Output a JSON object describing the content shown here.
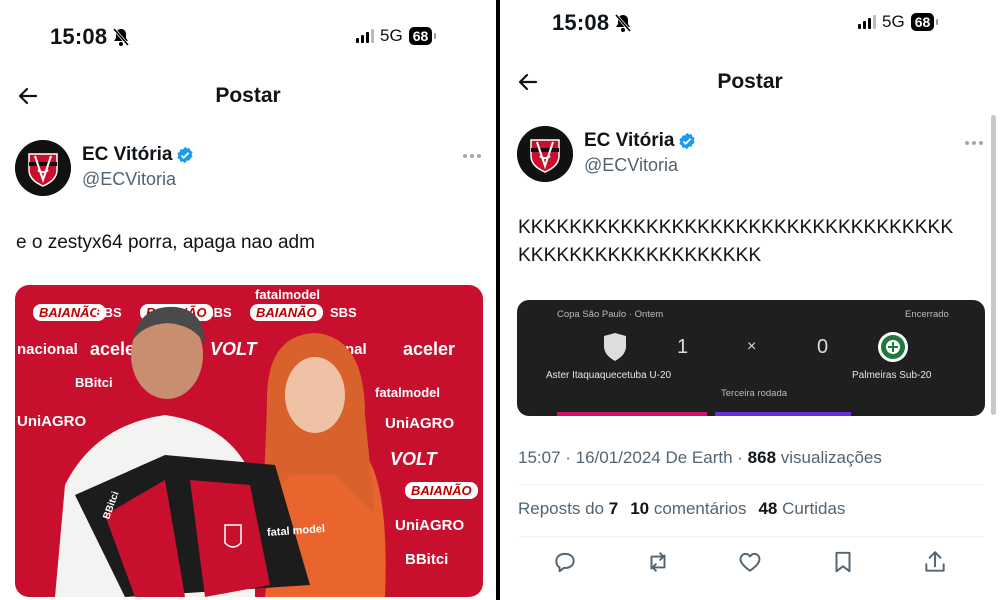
{
  "left": {
    "status": {
      "time": "15:08",
      "network": "5G",
      "battery": "68"
    },
    "nav": {
      "title": "Postar"
    },
    "author": {
      "name": "EC Vitória",
      "handle": "@ECVitoria"
    },
    "tweet_text": "e o zestyx64 porra, apaga nao adm",
    "photo": {
      "sponsors": [
        "fatalmodel",
        "BAIANÃO",
        "SBS",
        "BAIANÃO",
        "SBS",
        "BAIANÃO",
        "SBS",
        "nacional",
        "acele",
        "VOLT",
        "acional",
        "aceler",
        "BBitci",
        "fatalmodel",
        "UniAGRO",
        "UniAGRO",
        "VOLT",
        "BAIANÃO",
        "UniAGRO",
        "BBitci",
        "fatal model",
        "BBitci"
      ]
    }
  },
  "right": {
    "status": {
      "time": "15:08",
      "network": "5G",
      "battery": "68"
    },
    "nav": {
      "title": "Postar"
    },
    "author": {
      "name": "EC Vitória",
      "handle": "@ECVitoria"
    },
    "tweet_lines": [
      "KKKKKKKKKKKKKKKKKKKKKKKKKKKKKKKKKK",
      "KKKKKKKKKKKKKKKKKKK"
    ],
    "match_card": {
      "competition": "Copa São Paulo · Ontem",
      "status": "Encerrado",
      "home_team": "Aster Itaquaquecetuba U-20",
      "home_score": "1",
      "separator": "×",
      "away_score": "0",
      "away_team": "Palmeiras Sub-20",
      "round": "Terceira rodada"
    },
    "meta": {
      "time_date": "15:07 · 16/01/2024 De Earth · ",
      "views_count": "868",
      "views_label": " visualizações"
    },
    "stats": {
      "reposts_label": "Reposts do",
      "reposts": "7",
      "comments": "10",
      "comments_label": "comentários",
      "likes": "48",
      "likes_label": "Curtidas"
    },
    "colors": {
      "accent": "#1d9bf0",
      "verified": "#1d9bf0",
      "text": "#0f1419",
      "muted": "#536471"
    }
  }
}
